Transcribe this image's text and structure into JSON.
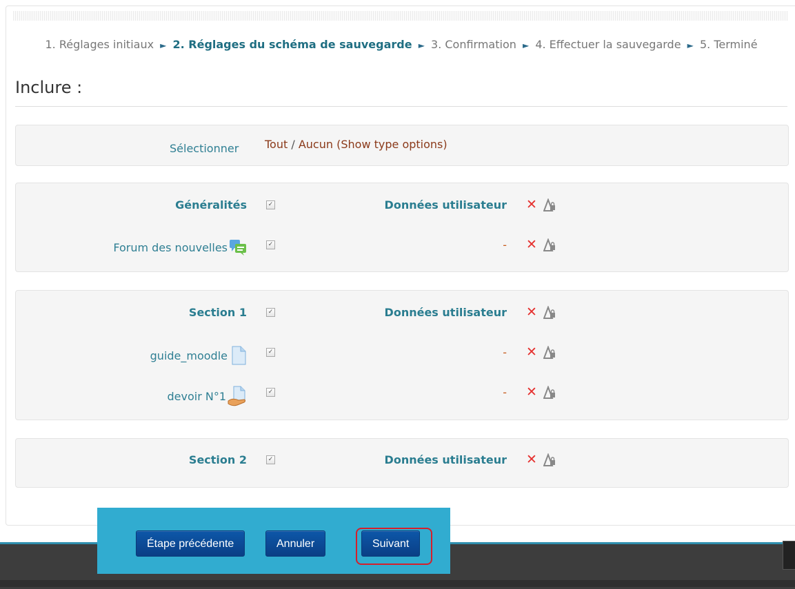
{
  "progress": {
    "step1": "1. Réglages initiaux",
    "step2": "2. Réglages du schéma de sauvegarde",
    "step3": "3. Confirmation",
    "step4": "4. Effectuer la sauvegarde",
    "step5": "5. Terminé",
    "arrow": "►"
  },
  "heading": "Inclure :",
  "select_row": {
    "label": "Sélectionner",
    "all": "Tout",
    "sep": "/",
    "none": "Aucun",
    "type_options": "(Show type options)"
  },
  "groups": [
    {
      "title": "Généralités",
      "user_data": "Données utilisateur",
      "items": [
        {
          "label": "Forum des nouvelles",
          "icon": "forum-icon",
          "user_data": "-"
        }
      ]
    },
    {
      "title": "Section 1",
      "user_data": "Données utilisateur",
      "items": [
        {
          "label": "guide_moodle",
          "icon": "file-icon",
          "user_data": "-"
        },
        {
          "label": "devoir N°1",
          "icon": "assignment-icon",
          "user_data": "-"
        }
      ]
    },
    {
      "title": "Section 2",
      "user_data": "Données utilisateur",
      "items": []
    }
  ],
  "checkbox_mark": "✓",
  "x_mark": "✕",
  "buttons": {
    "previous": "Étape précédente",
    "cancel": "Annuler",
    "next": "Suivant"
  },
  "colors": {
    "accent": "#2a7d90",
    "button": "#0d57a8",
    "bar": "#31acd0",
    "highlight_ring": "#d61e2a"
  }
}
